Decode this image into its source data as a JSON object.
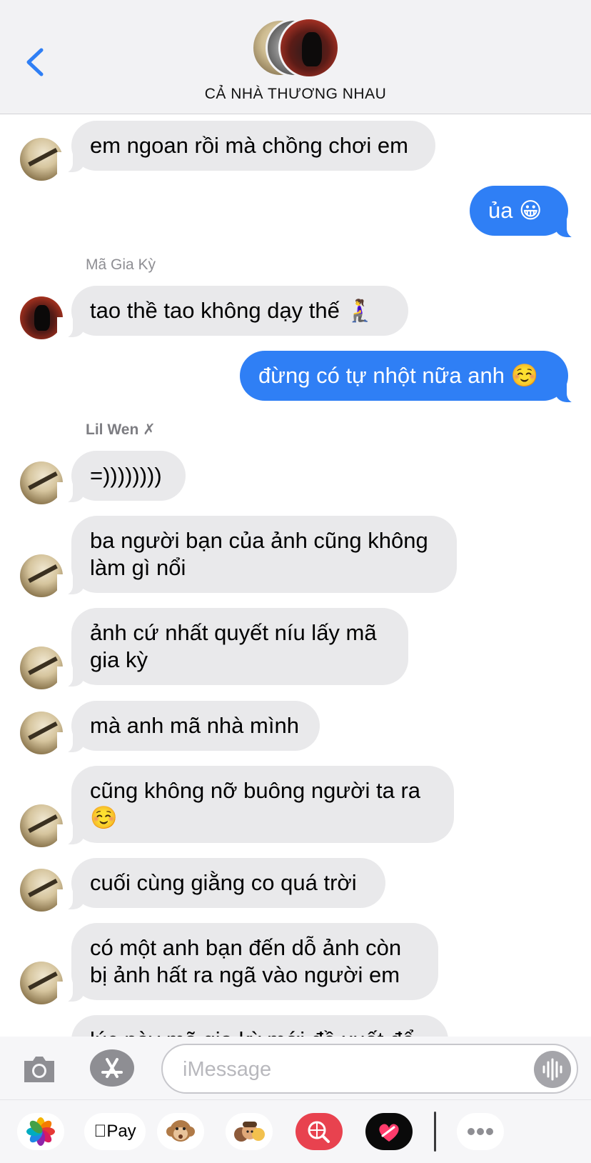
{
  "header": {
    "group_name": "CẢ NHÀ THƯƠNG NHAU"
  },
  "messages": [
    {
      "direction": "incoming",
      "sender_avatar": "avatar-wen",
      "text": "em ngoan rồi mà chồng chơi em"
    },
    {
      "direction": "outgoing",
      "text": "ủa 😀"
    },
    {
      "direction": "incoming",
      "sender": "Mã Gia Kỳ",
      "sender_avatar": "avatar-ma",
      "text": "tao thề tao không dạy thế 🧎‍♀️"
    },
    {
      "direction": "outgoing",
      "text": "đừng có tự nhột nữa anh ☺️"
    },
    {
      "direction": "incoming",
      "sender": "Lil Wen ✗",
      "sender_avatar": "avatar-wen",
      "text": "=))))))))"
    },
    {
      "direction": "incoming",
      "sender_avatar": "avatar-wen",
      "text": "ba người bạn của ảnh cũng không làm gì nổi"
    },
    {
      "direction": "incoming",
      "sender_avatar": "avatar-wen",
      "text": "ảnh cứ nhất quyết níu lấy mã gia kỳ"
    },
    {
      "direction": "incoming",
      "sender_avatar": "avatar-wen",
      "text": "mà anh mã nhà mình"
    },
    {
      "direction": "incoming",
      "sender_avatar": "avatar-wen",
      "text": "cũng không nỡ buông người ta ra ☺️"
    },
    {
      "direction": "incoming",
      "sender_avatar": "avatar-wen",
      "text": "cuối cùng giằng co quá trời"
    },
    {
      "direction": "incoming",
      "sender_avatar": "avatar-wen",
      "text": "có một anh bạn đến dỗ ảnh còn bị ảnh hất ra ngã vào người em"
    },
    {
      "direction": "incoming",
      "text": "lúc này mã gia kỳ mới đề xuất để"
    }
  ],
  "input": {
    "placeholder": "iMessage"
  },
  "drawer": {
    "apple_pay_label": "Pay",
    "apps": [
      "photos-icon",
      "apple-pay-icon",
      "animoji-monkey-icon",
      "memoji-icon",
      "web-search-icon",
      "digital-touch-icon",
      "more-icon"
    ]
  },
  "colors": {
    "outgoing_bubble": "#2f7ff5",
    "incoming_bubble": "#e9e9eb",
    "accent": "#2f7ff5"
  }
}
